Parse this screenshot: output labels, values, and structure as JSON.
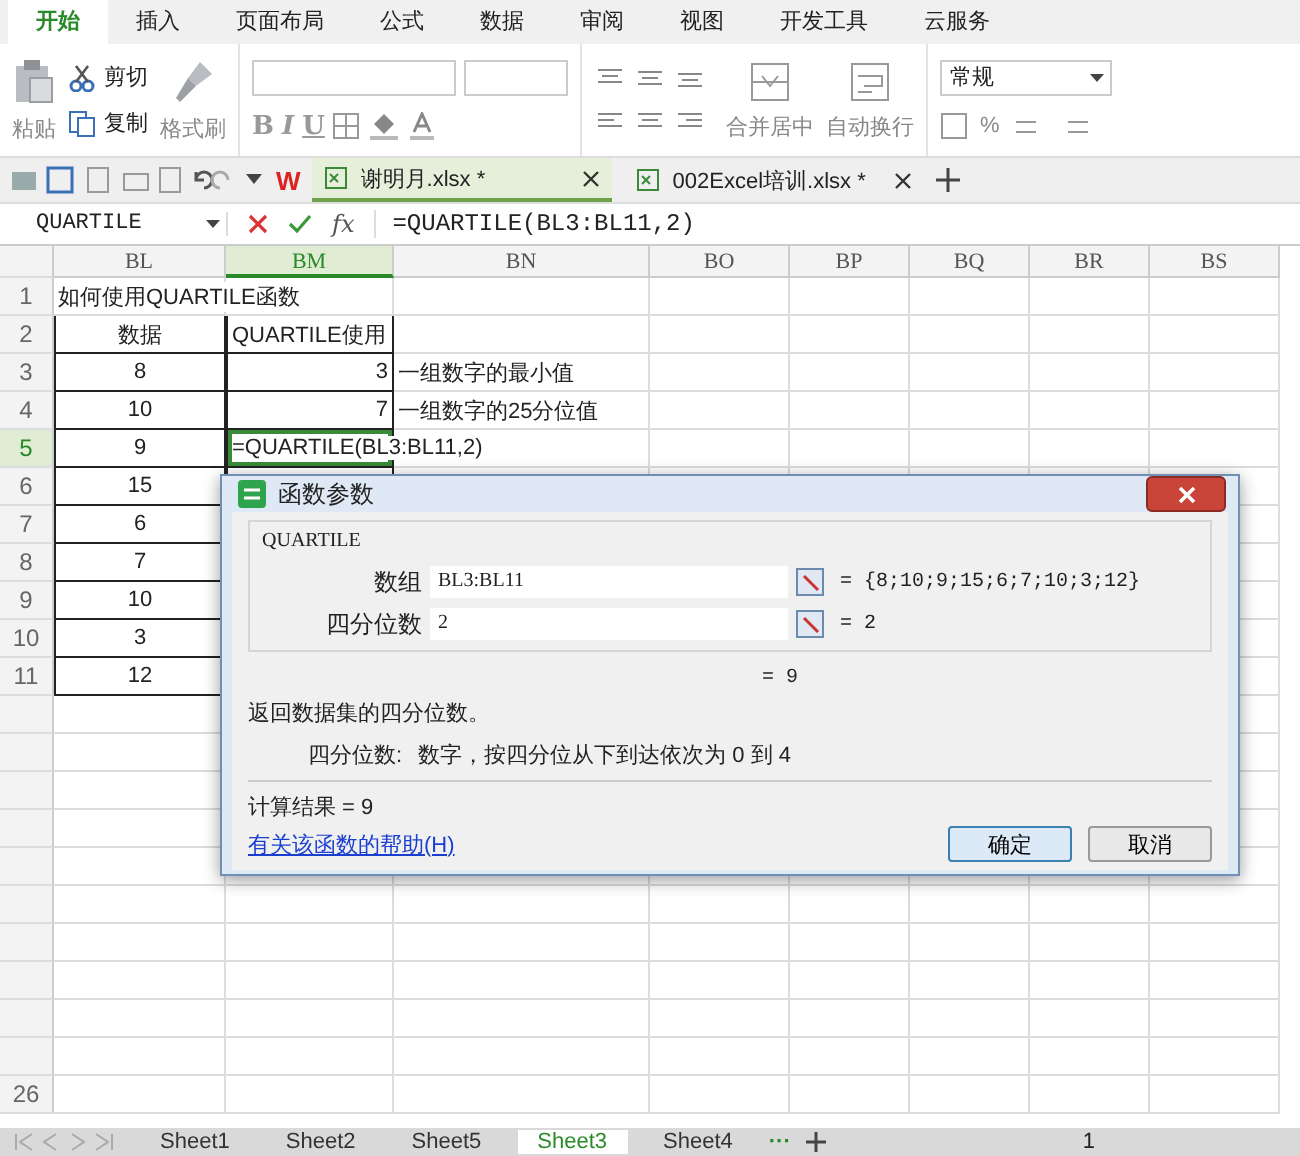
{
  "ribbon_tabs": [
    {
      "label": "开始",
      "selected": true
    },
    {
      "label": "插入",
      "selected": false
    },
    {
      "label": "页面布局",
      "selected": false
    },
    {
      "label": "公式",
      "selected": false
    },
    {
      "label": "数据",
      "selected": false
    },
    {
      "label": "审阅",
      "selected": false
    },
    {
      "label": "视图",
      "selected": false
    },
    {
      "label": "开发工具",
      "selected": false
    },
    {
      "label": "云服务",
      "selected": false
    }
  ],
  "ribbon": {
    "paste": "粘贴",
    "cut": "剪切",
    "copy": "复制",
    "format_painter": "格式刷",
    "bold": "B",
    "italic": "I",
    "underline": "U",
    "merge": "合并居中",
    "wrap": "自动换行",
    "number_format": "常规",
    "percent": "%"
  },
  "app_logo": "W",
  "doc_tabs": [
    {
      "label": "谢明月.xlsx *",
      "selected": true
    },
    {
      "label": "002Excel培训.xlsx *",
      "selected": false
    }
  ],
  "formula_bar": {
    "name_box": "QUARTILE",
    "fx": "fx",
    "formula": "=QUARTILE(BL3:BL11,2)"
  },
  "sheet": {
    "columns": [
      {
        "label": "BL",
        "selected": false
      },
      {
        "label": "BM",
        "selected": true
      },
      {
        "label": "BN",
        "selected": false
      },
      {
        "label": "BO",
        "selected": false
      },
      {
        "label": "BP",
        "selected": false
      },
      {
        "label": "BQ",
        "selected": false
      },
      {
        "label": "BR",
        "selected": false
      },
      {
        "label": "BS",
        "selected": false
      }
    ],
    "rows": [
      {
        "number": "1",
        "selected": false,
        "boxed": false,
        "bl": {
          "text": "如何使用QUARTILE函数",
          "kind": "text"
        }
      },
      {
        "number": "2",
        "selected": false,
        "boxed": true,
        "bl": {
          "text": "数据",
          "kind": "center"
        },
        "bm": {
          "text": "QUARTILE使用",
          "kind": "text"
        }
      },
      {
        "number": "3",
        "selected": false,
        "boxed": true,
        "bl": {
          "text": "8",
          "kind": "center"
        },
        "bm": {
          "text": "3",
          "kind": "number"
        },
        "bn": {
          "text": "一组数字的最小值",
          "kind": "text"
        }
      },
      {
        "number": "4",
        "selected": false,
        "boxed": true,
        "bl": {
          "text": "10",
          "kind": "center"
        },
        "bm": {
          "text": "7",
          "kind": "number"
        },
        "bn": {
          "text": "一组数字的25分位值",
          "kind": "text"
        }
      },
      {
        "number": "5",
        "selected": true,
        "boxed": true,
        "bl": {
          "text": "9",
          "kind": "center"
        },
        "bm": {
          "text": "=QUARTILE(BL3:BL11,2)",
          "kind": "text"
        }
      },
      {
        "number": "6",
        "selected": false,
        "boxed": true,
        "bl": {
          "text": "15",
          "kind": "center"
        }
      },
      {
        "number": "7",
        "selected": false,
        "boxed": true,
        "bl": {
          "text": "6",
          "kind": "center"
        }
      },
      {
        "number": "8",
        "selected": false,
        "boxed": true,
        "bl": {
          "text": "7",
          "kind": "center"
        }
      },
      {
        "number": "9",
        "selected": false,
        "boxed": true,
        "bl": {
          "text": "10",
          "kind": "center"
        }
      },
      {
        "number": "10",
        "selected": false,
        "boxed": true,
        "bl": {
          "text": "3",
          "kind": "center"
        }
      },
      {
        "number": "11",
        "selected": false,
        "boxed": true,
        "bl": {
          "text": "12",
          "kind": "center"
        }
      }
    ],
    "last_row": "26"
  },
  "dialog": {
    "title": "函数参数",
    "function": "QUARTILE",
    "args": [
      {
        "label": "数组",
        "value": "BL3:BL11",
        "result": "= {8;10;9;15;6;7;10;3;12}"
      },
      {
        "label": "四分位数",
        "value": "2",
        "result": "= 2"
      }
    ],
    "formula_result": "= 9",
    "description": "返回数据集的四分位数。",
    "arg_name": "四分位数:",
    "arg_help": "数字，按四分位从下到达依次为 0 到 4",
    "calc_result": "计算结果 = 9",
    "help_link": "有关该函数的帮助(H)",
    "ok": "确定",
    "cancel": "取消"
  },
  "sheet_tabs": [
    {
      "label": "Sheet1",
      "selected": false
    },
    {
      "label": "Sheet2",
      "selected": false
    },
    {
      "label": "Sheet5",
      "selected": false
    },
    {
      "label": "Sheet3",
      "selected": true
    },
    {
      "label": "Sheet4",
      "selected": false
    }
  ],
  "more_sheets": "···",
  "page_number": "1"
}
